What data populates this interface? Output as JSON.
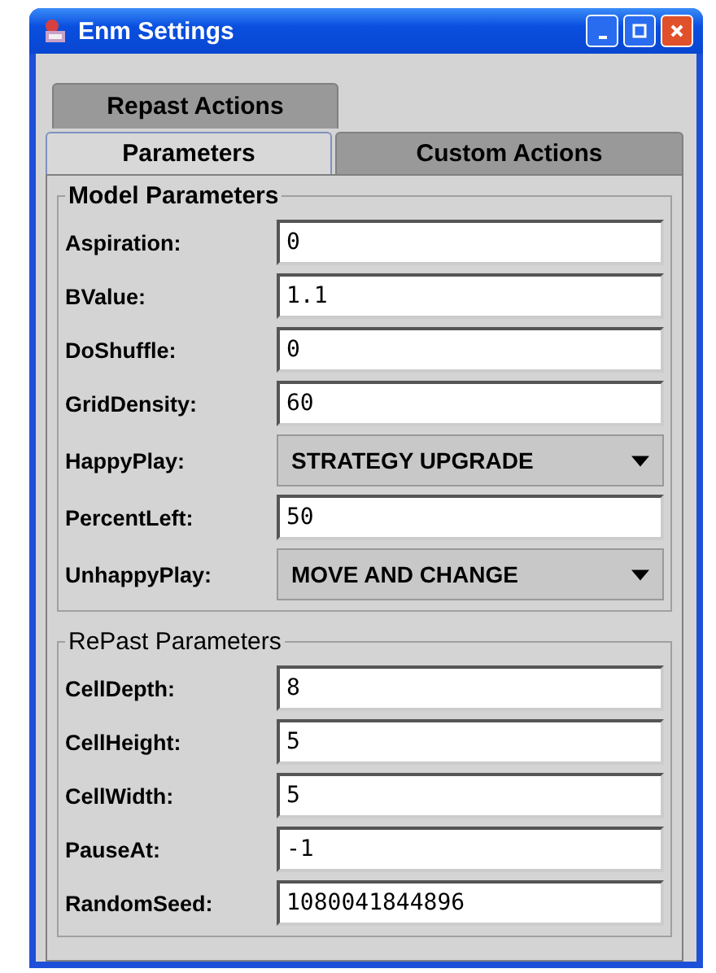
{
  "window": {
    "title": "Enm Settings"
  },
  "tab_rows": [
    [
      {
        "label": "Repast Actions",
        "selected": false
      }
    ],
    [
      {
        "label": "Parameters",
        "selected": true
      },
      {
        "label": "Custom Actions",
        "selected": false
      }
    ]
  ],
  "groups": [
    {
      "title": "Model Parameters",
      "fields": [
        {
          "label": "Aspiration:",
          "kind": "text",
          "value": "0"
        },
        {
          "label": "BValue:",
          "kind": "text",
          "value": "1.1"
        },
        {
          "label": "DoShuffle:",
          "kind": "text",
          "value": "0"
        },
        {
          "label": "GridDensity:",
          "kind": "text",
          "value": "60"
        },
        {
          "label": "HappyPlay:",
          "kind": "combo",
          "value": "STRATEGY UPGRADE"
        },
        {
          "label": "PercentLeft:",
          "kind": "text",
          "value": "50"
        },
        {
          "label": "UnhappyPlay:",
          "kind": "combo",
          "value": "MOVE AND CHANGE"
        }
      ]
    },
    {
      "title": "RePast Parameters",
      "fields": [
        {
          "label": "CellDepth:",
          "kind": "text",
          "value": "8"
        },
        {
          "label": "CellHeight:",
          "kind": "text",
          "value": "5"
        },
        {
          "label": "CellWidth:",
          "kind": "text",
          "value": "5"
        },
        {
          "label": "PauseAt:",
          "kind": "text",
          "value": "-1"
        },
        {
          "label": "RandomSeed:",
          "kind": "text",
          "value": "1080041844896"
        }
      ]
    }
  ]
}
